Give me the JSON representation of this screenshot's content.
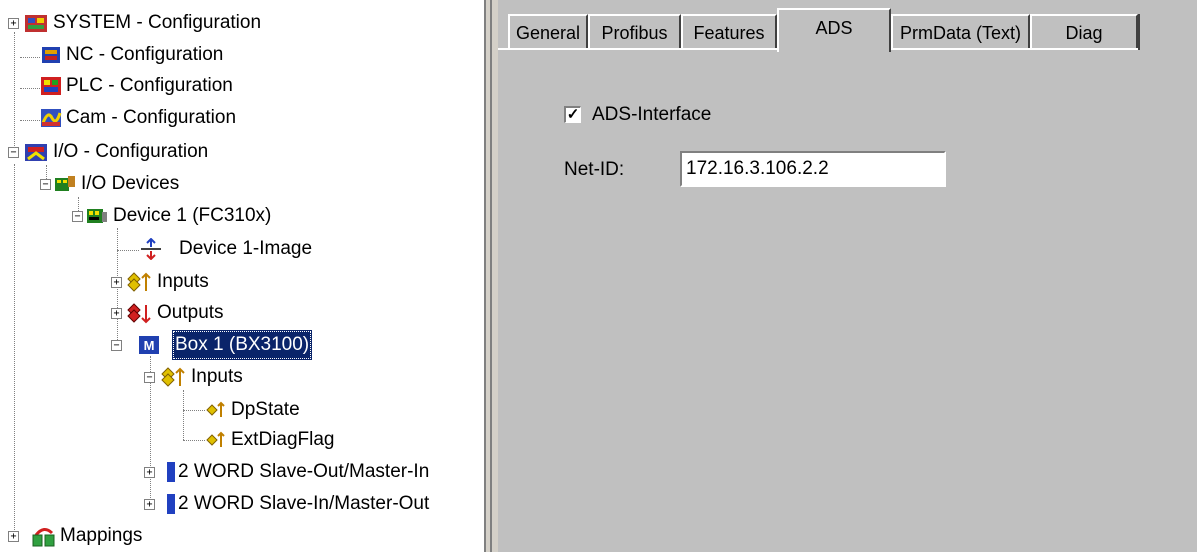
{
  "tree": {
    "nodes": [
      {
        "label": "SYSTEM - Configuration",
        "icon": "system-config-icon"
      },
      {
        "label": "NC - Configuration",
        "icon": "nc-config-icon"
      },
      {
        "label": "PLC - Configuration",
        "icon": "plc-config-icon"
      },
      {
        "label": "Cam - Configuration",
        "icon": "cam-config-icon"
      },
      {
        "label": "I/O - Configuration",
        "icon": "io-config-icon"
      },
      {
        "label": "I/O Devices",
        "icon": "io-devices-icon"
      },
      {
        "label": "Device 1 (FC310x)",
        "icon": "device-card-icon"
      },
      {
        "label": "Device 1-Image",
        "icon": "device-image-icon"
      },
      {
        "label": "Inputs",
        "icon": "inputs-icon"
      },
      {
        "label": "Outputs",
        "icon": "outputs-icon"
      },
      {
        "label": "Box 1 (BX3100)",
        "icon": "box-module-icon"
      },
      {
        "label": "Inputs",
        "icon": "inputs-icon"
      },
      {
        "label": "DpState",
        "icon": "input-variable-icon"
      },
      {
        "label": "ExtDiagFlag",
        "icon": "input-variable-icon"
      },
      {
        "label": "2 WORD Slave-Out/Master-In",
        "icon": "word-block-icon"
      },
      {
        "label": "2 WORD Slave-In/Master-Out",
        "icon": "word-block-icon"
      },
      {
        "label": "Mappings",
        "icon": "mappings-icon"
      }
    ],
    "selected": "Box 1 (BX3100)"
  },
  "tabs": [
    {
      "label": "General"
    },
    {
      "label": "Profibus"
    },
    {
      "label": "Features"
    },
    {
      "label": "ADS",
      "active": true
    },
    {
      "label": "PrmData (Text)"
    },
    {
      "label": "Diag"
    }
  ],
  "ads": {
    "checkbox_label": "ADS-Interface",
    "checked": true,
    "check_mark": "✓",
    "netid_label": "Net-ID:",
    "netid_value": "172.16.3.106.2.2"
  },
  "colors": {
    "selection": "#0a246a",
    "panel": "#c0c0c0"
  }
}
